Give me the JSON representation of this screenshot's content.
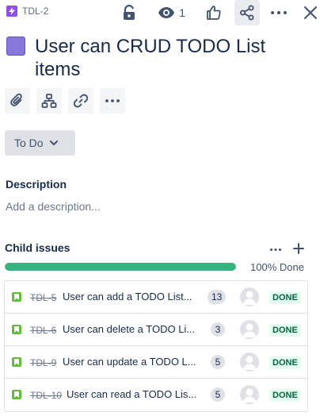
{
  "header": {
    "issue_key": "TDL-2",
    "watch_count": "1"
  },
  "title": "User can CRUD TODO List items",
  "status": {
    "label": "To Do"
  },
  "description": {
    "label": "Description",
    "placeholder": "Add a description..."
  },
  "child_issues": {
    "label": "Child issues",
    "progress_fraction": 1.0,
    "progress_text": "100% Done",
    "items": [
      {
        "key": "TDL-5",
        "summary": "User can add a TODO List...",
        "points": "13",
        "status": "DONE"
      },
      {
        "key": "TDL-6",
        "summary": "User can delete a TODO Li...",
        "points": "3",
        "status": "DONE"
      },
      {
        "key": "TDL-9",
        "summary": "User can update a TODO L...",
        "points": "5",
        "status": "DONE"
      },
      {
        "key": "TDL-10",
        "summary": "User can read a TODO Lis...",
        "points": "5",
        "status": "DONE"
      }
    ]
  },
  "colors": {
    "epic": "#904ee2",
    "title_swatch": "#8777d9",
    "progress": "#36b37e",
    "story": "#63ba3c",
    "done_badge_bg": "#e3fcef",
    "done_badge_text": "#006644"
  },
  "icons": {
    "epic": "lightning-icon",
    "lock": "unlock-icon",
    "watch": "eye-icon",
    "like": "thumbs-up-icon",
    "share": "share-icon",
    "more": "ellipsis-icon",
    "close": "close-icon",
    "attach": "paperclip-icon",
    "child_issue": "hierarchy-icon",
    "link": "link-icon",
    "story": "bookmark-icon",
    "avatar": "user-icon"
  }
}
